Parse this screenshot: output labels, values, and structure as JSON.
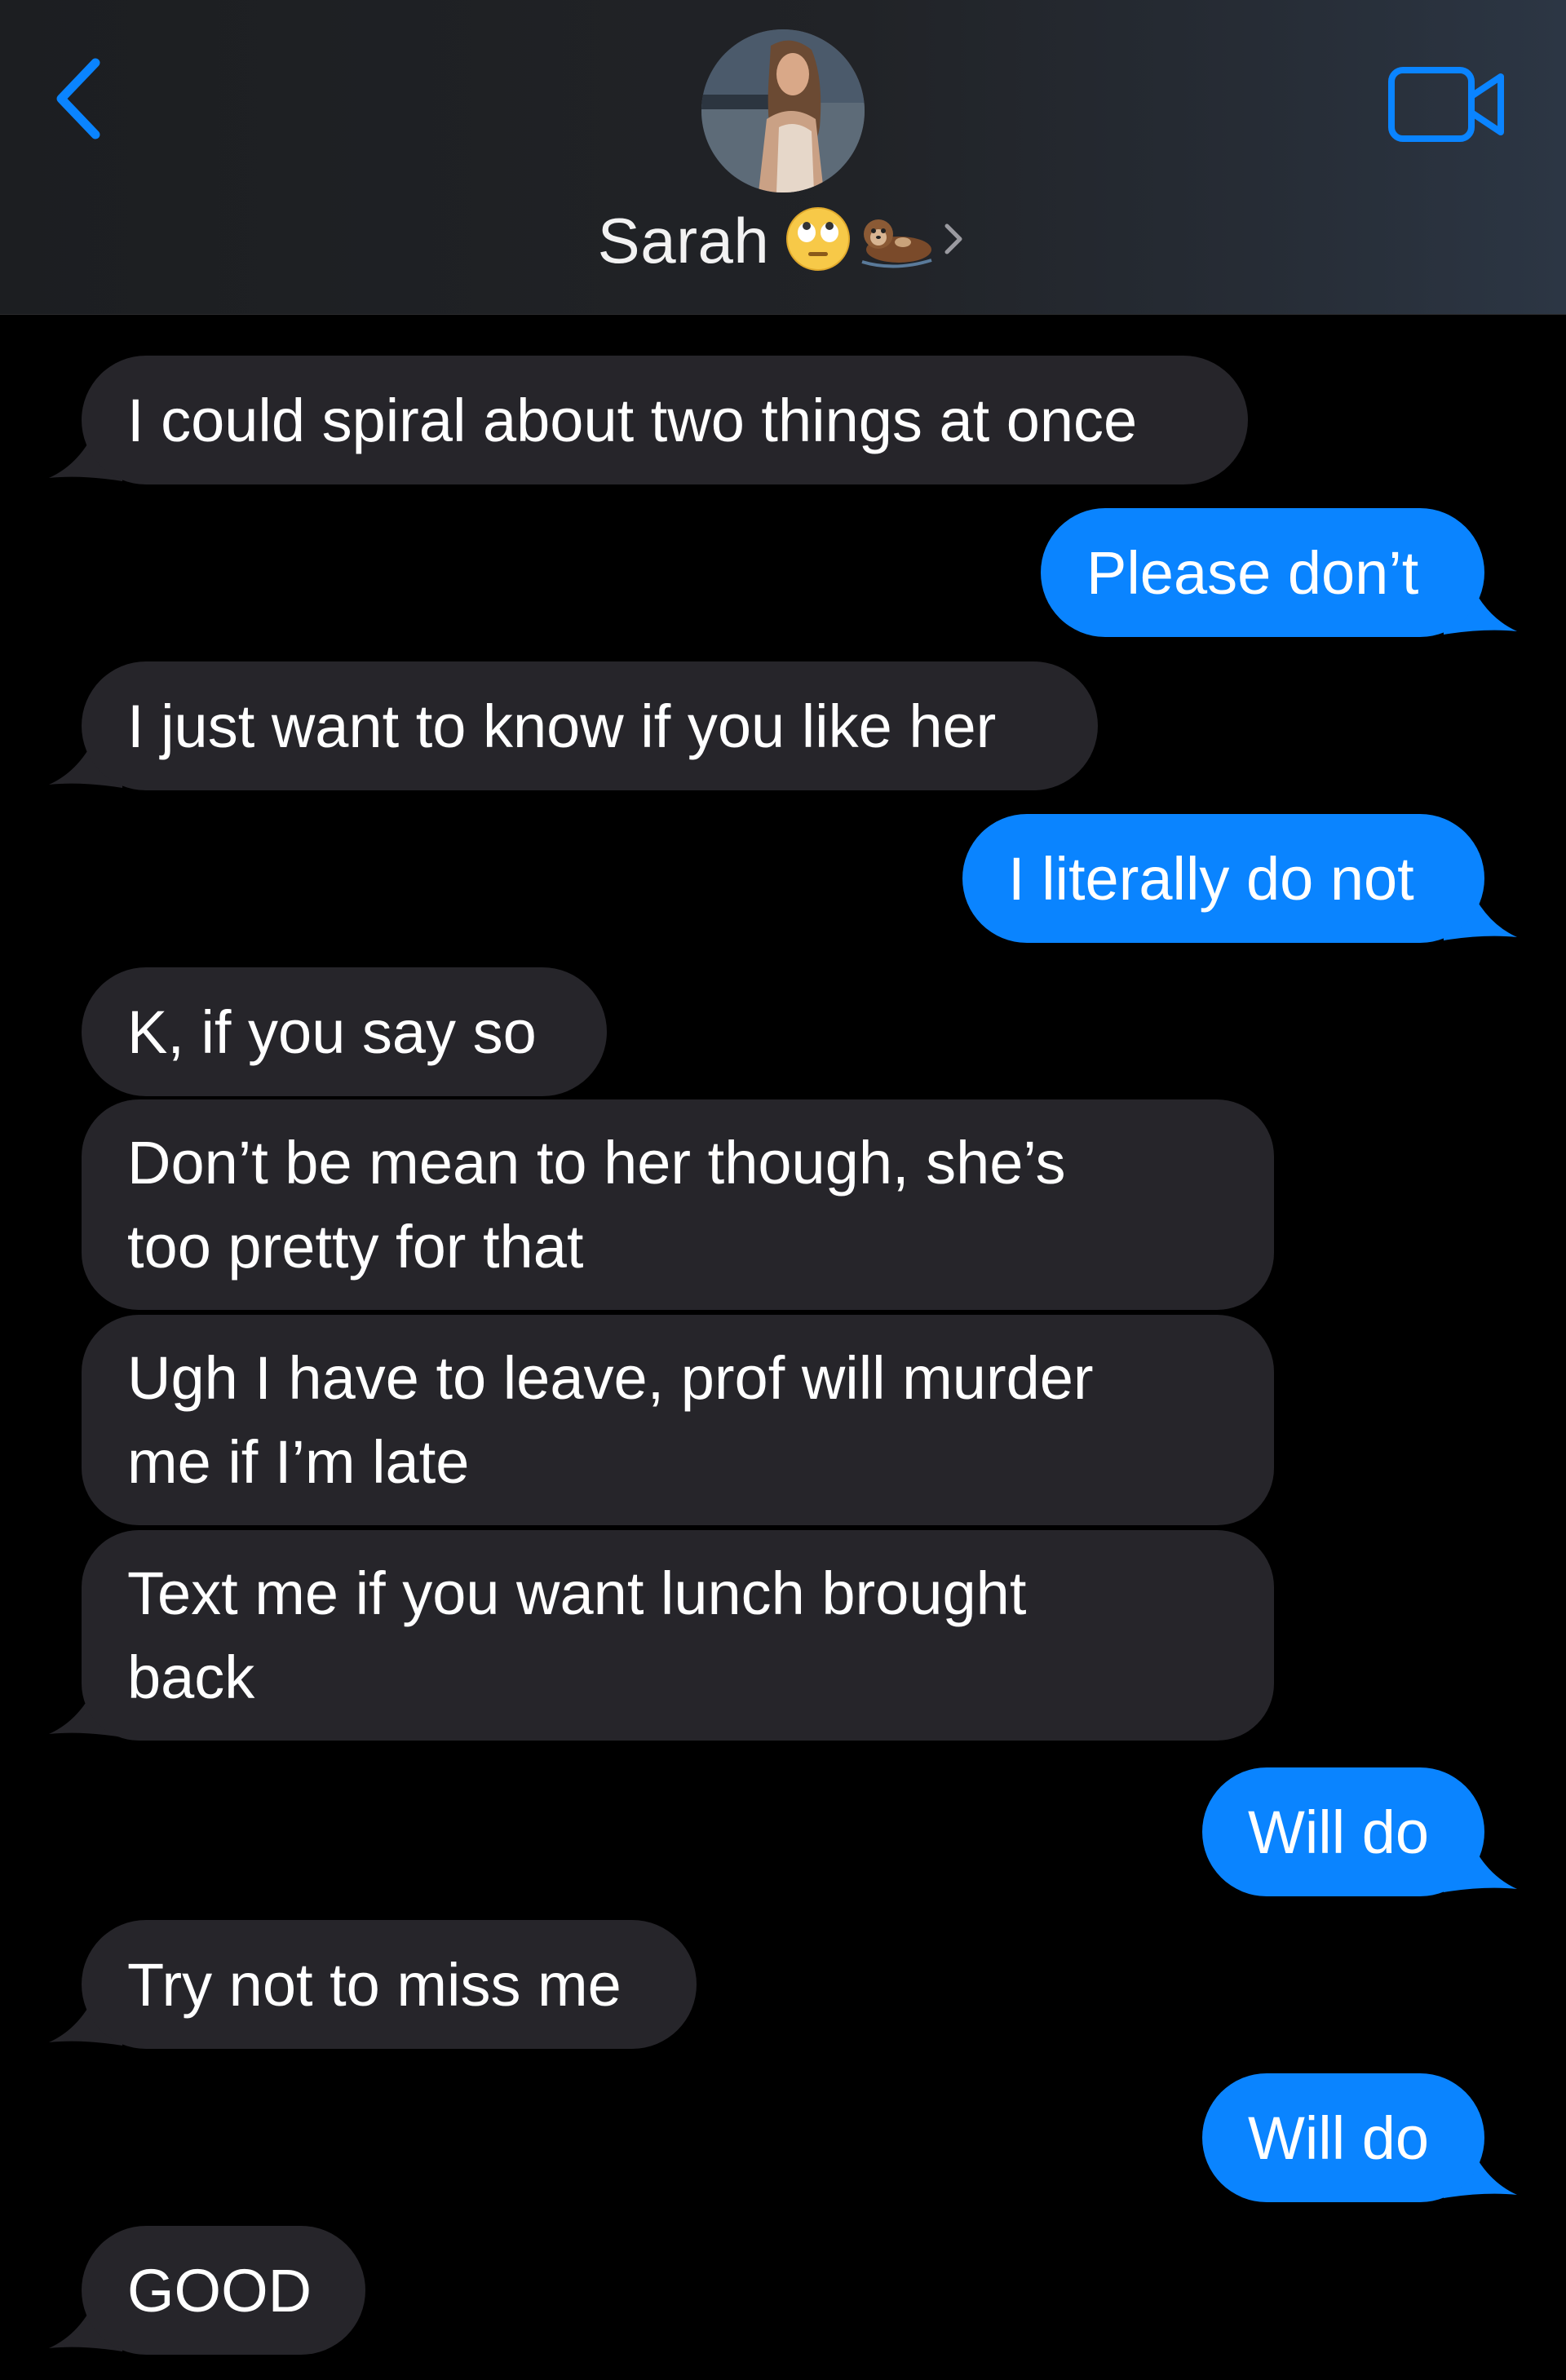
{
  "header": {
    "contact_name": "Sarah",
    "back_icon": "chevron-left-icon",
    "video_icon": "video-camera-icon",
    "name_emojis": [
      "face-with-rolling-eyes-emoji",
      "otter-emoji"
    ],
    "accent_color": "#0a84ff"
  },
  "messages": [
    {
      "id": 1,
      "sender": "them",
      "text": "I could spiral about two things at once"
    },
    {
      "id": 2,
      "sender": "me",
      "text": "Please don’t"
    },
    {
      "id": 3,
      "sender": "them",
      "text": "I just want to know if you like her"
    },
    {
      "id": 4,
      "sender": "me",
      "text": "I literally do not"
    },
    {
      "id": 5,
      "sender": "them",
      "text": "K, if you say so"
    },
    {
      "id": 6,
      "sender": "them",
      "text": "Don’t be mean to her though, she’s\ntoo pretty for that"
    },
    {
      "id": 7,
      "sender": "them",
      "text": "Ugh I have to leave, prof will murder\nme if I’m late"
    },
    {
      "id": 8,
      "sender": "them",
      "text": "Text me if you want lunch brought\nback"
    },
    {
      "id": 9,
      "sender": "me",
      "text": "Will do"
    },
    {
      "id": 10,
      "sender": "them",
      "text": "Try not to miss me"
    },
    {
      "id": 11,
      "sender": "me",
      "text": "Will do"
    },
    {
      "id": 12,
      "sender": "them",
      "text": "GOOD"
    }
  ],
  "colors": {
    "incoming_bubble": "#26252a",
    "outgoing_bubble": "#0a84ff",
    "background": "#000000"
  }
}
